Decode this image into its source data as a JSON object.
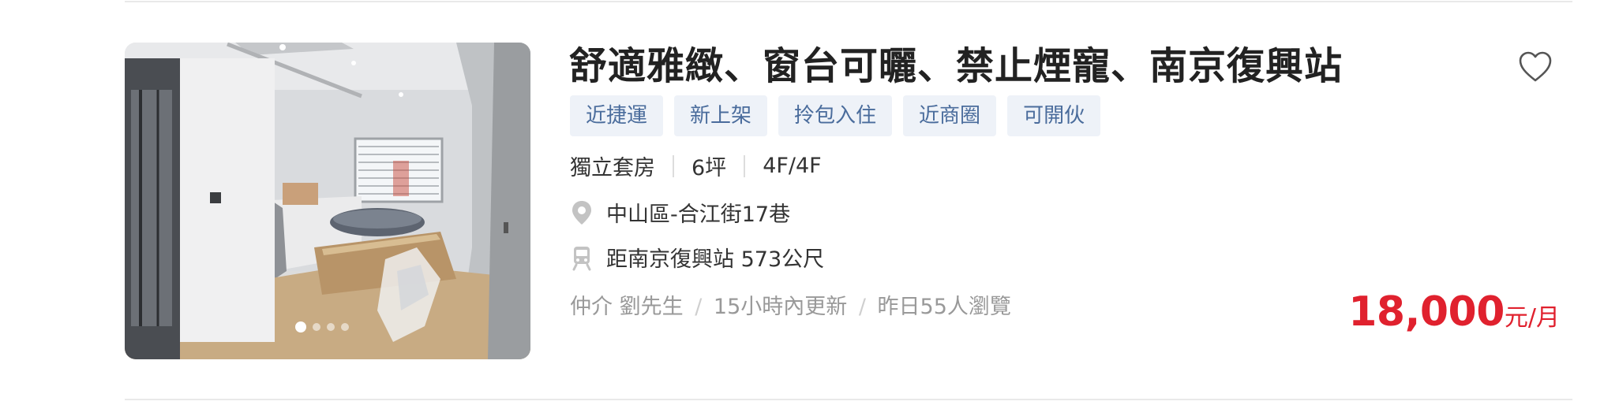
{
  "listing": {
    "title": "舒適雅緻、窗台可曬、禁止煙寵、南京復興站",
    "tags": [
      "近捷運",
      "新上架",
      "拎包入住",
      "近商圈",
      "可開伙"
    ],
    "specs": [
      "獨立套房",
      "6坪",
      "4F/4F"
    ],
    "address": "中山區-合江街17巷",
    "distance": "距南京復興站 573公尺",
    "agent": "仲介 劉先生",
    "updated": "15小時內更新",
    "views": "昨日55人瀏覽",
    "meta_separator": "/",
    "price": "18,000",
    "price_unit": "元/月",
    "photo_count": 4,
    "photo_active_index": 0,
    "icons": {
      "favorite": "heart-outline-icon",
      "address": "map-pin-icon",
      "distance": "train-icon"
    },
    "colors": {
      "price": "#e0212e",
      "tag_text": "#4a6c9c",
      "tag_bg": "#eef2f8"
    }
  }
}
